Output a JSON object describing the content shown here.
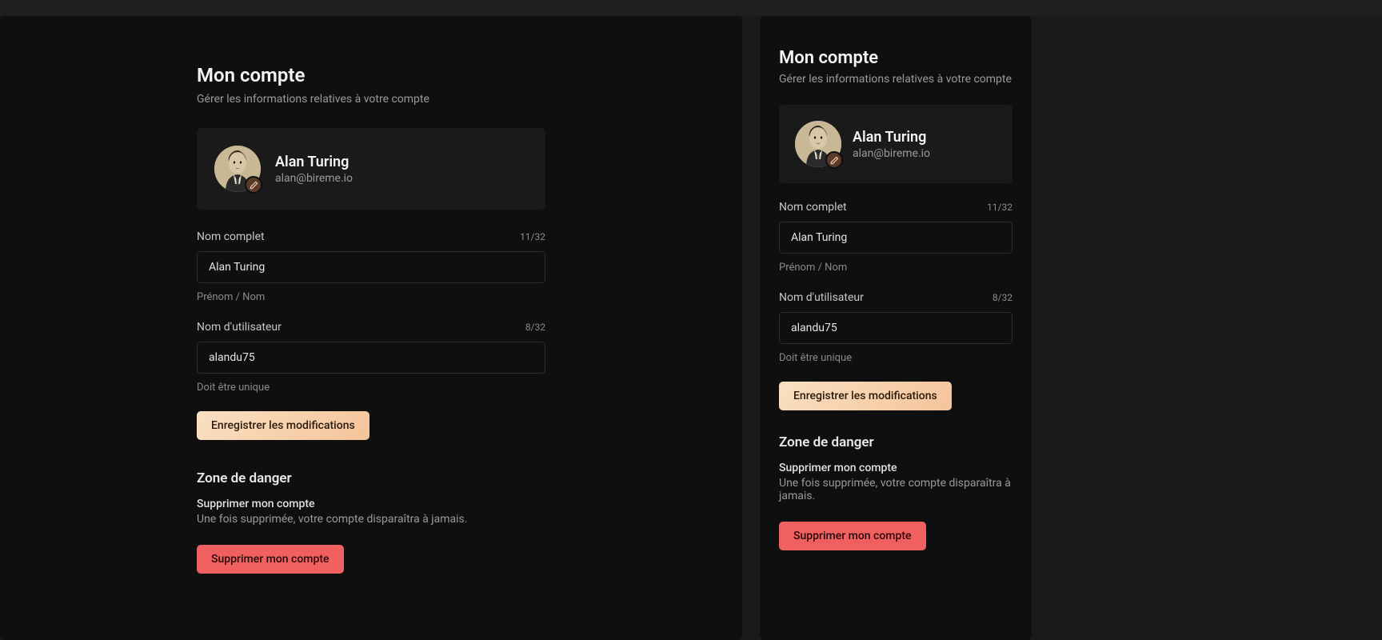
{
  "header": {
    "title": "Mon compte",
    "subtitle": "Gérer les informations relatives à votre compte"
  },
  "profile": {
    "name": "Alan Turing",
    "email": "alan@bireme.io",
    "edit_icon": "pencil-icon"
  },
  "fields": {
    "fullname": {
      "label": "Nom complet",
      "value": "Alan Turing",
      "count": "11/32",
      "hint": "Prénom / Nom"
    },
    "username": {
      "label": "Nom d'utilisateur",
      "value": "alandu75",
      "count": "8/32",
      "hint": "Doit être unique"
    }
  },
  "actions": {
    "save": "Enregistrer les modifications"
  },
  "danger": {
    "heading": "Zone de danger",
    "title": "Supprimer mon compte",
    "description": "Une fois supprimée, votre compte disparaîtra à jamais.",
    "button": "Supprimer mon compte"
  }
}
